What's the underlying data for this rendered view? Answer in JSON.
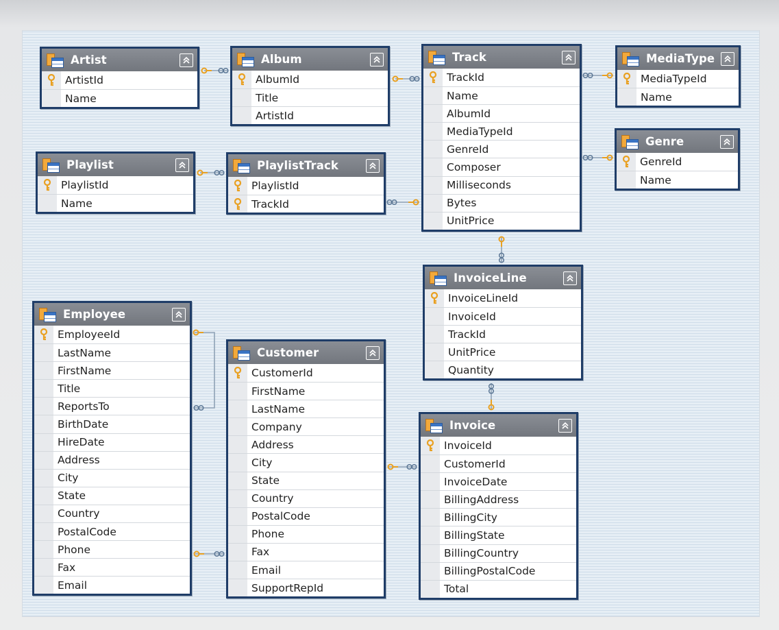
{
  "tables": [
    {
      "name": "Artist",
      "columns": [
        {
          "name": "ArtistId",
          "pk": true
        },
        {
          "name": "Name",
          "pk": false
        }
      ]
    },
    {
      "name": "Album",
      "columns": [
        {
          "name": "AlbumId",
          "pk": true
        },
        {
          "name": "Title",
          "pk": false
        },
        {
          "name": "ArtistId",
          "pk": false
        }
      ]
    },
    {
      "name": "Track",
      "columns": [
        {
          "name": "TrackId",
          "pk": true
        },
        {
          "name": "Name",
          "pk": false
        },
        {
          "name": "AlbumId",
          "pk": false
        },
        {
          "name": "MediaTypeId",
          "pk": false
        },
        {
          "name": "GenreId",
          "pk": false
        },
        {
          "name": "Composer",
          "pk": false
        },
        {
          "name": "Milliseconds",
          "pk": false
        },
        {
          "name": "Bytes",
          "pk": false
        },
        {
          "name": "UnitPrice",
          "pk": false
        }
      ]
    },
    {
      "name": "MediaType",
      "columns": [
        {
          "name": "MediaTypeId",
          "pk": true
        },
        {
          "name": "Name",
          "pk": false
        }
      ]
    },
    {
      "name": "Genre",
      "columns": [
        {
          "name": "GenreId",
          "pk": true
        },
        {
          "name": "Name",
          "pk": false
        }
      ]
    },
    {
      "name": "Playlist",
      "columns": [
        {
          "name": "PlaylistId",
          "pk": true
        },
        {
          "name": "Name",
          "pk": false
        }
      ]
    },
    {
      "name": "PlaylistTrack",
      "columns": [
        {
          "name": "PlaylistId",
          "pk": true
        },
        {
          "name": "TrackId",
          "pk": true
        }
      ]
    },
    {
      "name": "InvoiceLine",
      "columns": [
        {
          "name": "InvoiceLineId",
          "pk": true
        },
        {
          "name": "InvoiceId",
          "pk": false
        },
        {
          "name": "TrackId",
          "pk": false
        },
        {
          "name": "UnitPrice",
          "pk": false
        },
        {
          "name": "Quantity",
          "pk": false
        }
      ]
    },
    {
      "name": "Employee",
      "columns": [
        {
          "name": "EmployeeId",
          "pk": true
        },
        {
          "name": "LastName",
          "pk": false
        },
        {
          "name": "FirstName",
          "pk": false
        },
        {
          "name": "Title",
          "pk": false
        },
        {
          "name": "ReportsTo",
          "pk": false
        },
        {
          "name": "BirthDate",
          "pk": false
        },
        {
          "name": "HireDate",
          "pk": false
        },
        {
          "name": "Address",
          "pk": false
        },
        {
          "name": "City",
          "pk": false
        },
        {
          "name": "State",
          "pk": false
        },
        {
          "name": "Country",
          "pk": false
        },
        {
          "name": "PostalCode",
          "pk": false
        },
        {
          "name": "Phone",
          "pk": false
        },
        {
          "name": "Fax",
          "pk": false
        },
        {
          "name": "Email",
          "pk": false
        }
      ]
    },
    {
      "name": "Customer",
      "columns": [
        {
          "name": "CustomerId",
          "pk": true
        },
        {
          "name": "FirstName",
          "pk": false
        },
        {
          "name": "LastName",
          "pk": false
        },
        {
          "name": "Company",
          "pk": false
        },
        {
          "name": "Address",
          "pk": false
        },
        {
          "name": "City",
          "pk": false
        },
        {
          "name": "State",
          "pk": false
        },
        {
          "name": "Country",
          "pk": false
        },
        {
          "name": "PostalCode",
          "pk": false
        },
        {
          "name": "Phone",
          "pk": false
        },
        {
          "name": "Fax",
          "pk": false
        },
        {
          "name": "Email",
          "pk": false
        },
        {
          "name": "SupportRepId",
          "pk": false
        }
      ]
    },
    {
      "name": "Invoice",
      "columns": [
        {
          "name": "InvoiceId",
          "pk": true
        },
        {
          "name": "CustomerId",
          "pk": false
        },
        {
          "name": "InvoiceDate",
          "pk": false
        },
        {
          "name": "BillingAddress",
          "pk": false
        },
        {
          "name": "BillingCity",
          "pk": false
        },
        {
          "name": "BillingState",
          "pk": false
        },
        {
          "name": "BillingCountry",
          "pk": false
        },
        {
          "name": "BillingPostalCode",
          "pk": false
        },
        {
          "name": "Total",
          "pk": false
        }
      ]
    }
  ],
  "relationships": [
    {
      "one": "Artist",
      "many": "Album"
    },
    {
      "one": "Album",
      "many": "Track"
    },
    {
      "one": "MediaType",
      "many": "Track"
    },
    {
      "one": "Genre",
      "many": "Track"
    },
    {
      "one": "Playlist",
      "many": "PlaylistTrack"
    },
    {
      "one": "Track",
      "many": "PlaylistTrack"
    },
    {
      "one": "Track",
      "many": "InvoiceLine"
    },
    {
      "one": "Invoice",
      "many": "InvoiceLine"
    },
    {
      "one": "Employee",
      "many": "Employee"
    },
    {
      "one": "Employee",
      "many": "Customer"
    },
    {
      "one": "Customer",
      "many": "Invoice"
    }
  ],
  "icons": {
    "table": "table-icon",
    "primary_key": "key-icon",
    "collapse": "collapse-icon"
  },
  "colors": {
    "border": "#1f3d68",
    "header": "#7d8188",
    "key": "#e9a020",
    "link": "#8fa2b6"
  }
}
